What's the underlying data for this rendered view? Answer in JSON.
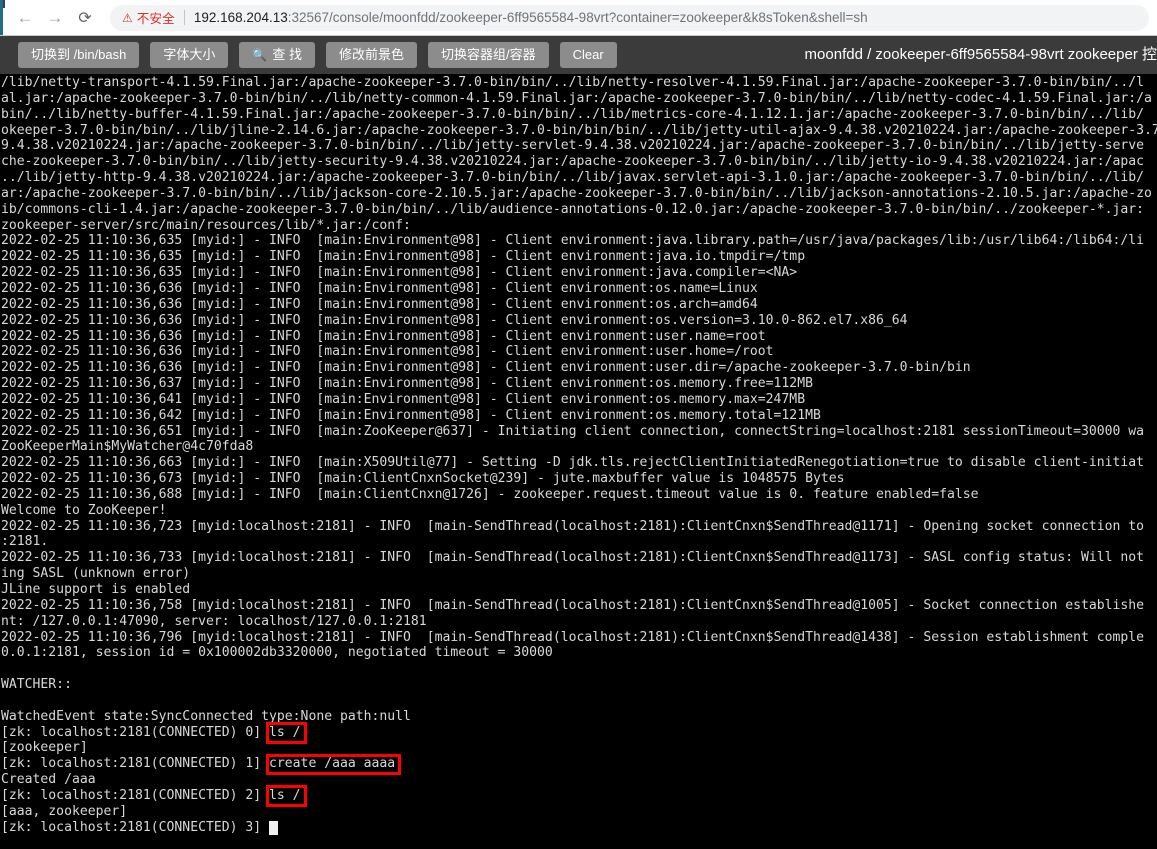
{
  "browser": {
    "back_icon": "back-arrow-icon",
    "forward_icon": "forward-arrow-icon",
    "reload_icon": "reload-icon",
    "security_warning_icon": "warning-triangle-icon",
    "security_warning_text": "不安全",
    "url_host": "192.168.204.13",
    "url_rest": ":32567/console/moonfdd/zookeeper-6ff9565584-98vrt?container=zookeeper&k8sToken&shell=sh",
    "url_full": "192.168.204.13:32567/console/moonfdd/zookeeper-6ff9565584-98vrt?container=zookeeper&k8sToken&shell=sh"
  },
  "toolbar": {
    "buttons": [
      {
        "label": "切换到 /bin/bash",
        "name": "switch-to-bin-bash-button",
        "icon": ""
      },
      {
        "label": "字体大小",
        "name": "font-size-button",
        "icon": ""
      },
      {
        "label": "查 找",
        "name": "find-button",
        "icon": "search-icon"
      },
      {
        "label": "修改前景色",
        "name": "change-foreground-color-button",
        "icon": ""
      },
      {
        "label": "切换容器组/容器",
        "name": "switch-pod-container-button",
        "icon": ""
      },
      {
        "label": "Clear",
        "name": "clear-button",
        "icon": ""
      }
    ],
    "heading": "moonfdd / zookeeper-6ff9565584-98vrt zookeeper 控"
  },
  "terminal": {
    "accent_highlight_color": "#ff0000",
    "foreground_color": "#d8d8d8",
    "background_color": "#000000",
    "lines": [
      "/lib/netty-transport-4.1.59.Final.jar:/apache-zookeeper-3.7.0-bin/bin/../lib/netty-resolver-4.1.59.Final.jar:/apache-zookeeper-3.7.0-bin/bin/../l",
      "al.jar:/apache-zookeeper-3.7.0-bin/bin/../lib/netty-common-4.1.59.Final.jar:/apache-zookeeper-3.7.0-bin/bin/../lib/netty-codec-4.1.59.Final.jar:/a",
      "bin/../lib/netty-buffer-4.1.59.Final.jar:/apache-zookeeper-3.7.0-bin/bin/../lib/metrics-core-4.1.12.1.jar:/apache-zookeeper-3.7.0-bin/bin/../lib/",
      "okeeper-3.7.0-bin/bin/../lib/jline-2.14.6.jar:/apache-zookeeper-3.7.0-bin/bin/bin/../lib/jetty-util-ajax-9.4.38.v20210224.jar:/apache-zookeeper-3.7.0",
      "9.4.38.v20210224.jar:/apache-zookeeper-3.7.0-bin/bin/../lib/jetty-servlet-9.4.38.v20210224.jar:/apache-zookeeper-3.7.0-bin/bin/../lib/jetty-serve",
      "che-zookeeper-3.7.0-bin/bin/../lib/jetty-security-9.4.38.v20210224.jar:/apache-zookeeper-3.7.0-bin/bin/../lib/jetty-io-9.4.38.v20210224.jar:/apac",
      "../lib/jetty-http-9.4.38.v20210224.jar:/apache-zookeeper-3.7.0-bin/bin/../lib/javax.servlet-api-3.1.0.jar:/apache-zookeeper-3.7.0-bin/bin/../lib/",
      "ar:/apache-zookeeper-3.7.0-bin/bin/../lib/jackson-core-2.10.5.jar:/apache-zookeeper-3.7.0-bin/bin/../lib/jackson-annotations-2.10.5.jar:/apache-zo",
      "ib/commons-cli-1.4.jar:/apache-zookeeper-3.7.0-bin/bin/../lib/audience-annotations-0.12.0.jar:/apache-zookeeper-3.7.0-bin/bin/../zookeeper-*.jar:",
      "zookeeper-server/src/main/resources/lib/*.jar:/conf:",
      "2022-02-25 11:10:36,635 [myid:] - INFO  [main:Environment@98] - Client environment:java.library.path=/usr/java/packages/lib:/usr/lib64:/lib64:/li",
      "2022-02-25 11:10:36,635 [myid:] - INFO  [main:Environment@98] - Client environment:java.io.tmpdir=/tmp",
      "2022-02-25 11:10:36,635 [myid:] - INFO  [main:Environment@98] - Client environment:java.compiler=<NA>",
      "2022-02-25 11:10:36,636 [myid:] - INFO  [main:Environment@98] - Client environment:os.name=Linux",
      "2022-02-25 11:10:36,636 [myid:] - INFO  [main:Environment@98] - Client environment:os.arch=amd64",
      "2022-02-25 11:10:36,636 [myid:] - INFO  [main:Environment@98] - Client environment:os.version=3.10.0-862.el7.x86_64",
      "2022-02-25 11:10:36,636 [myid:] - INFO  [main:Environment@98] - Client environment:user.name=root",
      "2022-02-25 11:10:36,636 [myid:] - INFO  [main:Environment@98] - Client environment:user.home=/root",
      "2022-02-25 11:10:36,636 [myid:] - INFO  [main:Environment@98] - Client environment:user.dir=/apache-zookeeper-3.7.0-bin/bin",
      "2022-02-25 11:10:36,637 [myid:] - INFO  [main:Environment@98] - Client environment:os.memory.free=112MB",
      "2022-02-25 11:10:36,641 [myid:] - INFO  [main:Environment@98] - Client environment:os.memory.max=247MB",
      "2022-02-25 11:10:36,642 [myid:] - INFO  [main:Environment@98] - Client environment:os.memory.total=121MB",
      "2022-02-25 11:10:36,651 [myid:] - INFO  [main:ZooKeeper@637] - Initiating client connection, connectString=localhost:2181 sessionTimeout=30000 wa",
      "ZooKeeperMain$MyWatcher@4c70fda8",
      "2022-02-25 11:10:36,663 [myid:] - INFO  [main:X509Util@77] - Setting -D jdk.tls.rejectClientInitiatedRenegotiation=true to disable client-initiat",
      "2022-02-25 11:10:36,673 [myid:] - INFO  [main:ClientCnxnSocket@239] - jute.maxbuffer value is 1048575 Bytes",
      "2022-02-25 11:10:36,688 [myid:] - INFO  [main:ClientCnxn@1726] - zookeeper.request.timeout value is 0. feature enabled=false",
      "Welcome to ZooKeeper!",
      "2022-02-25 11:10:36,723 [myid:localhost:2181] - INFO  [main-SendThread(localhost:2181):ClientCnxn$SendThread@1171] - Opening socket connection to",
      ":2181.",
      "2022-02-25 11:10:36,733 [myid:localhost:2181] - INFO  [main-SendThread(localhost:2181):ClientCnxn$SendThread@1173] - SASL config status: Will not",
      "ing SASL (unknown error)",
      "JLine support is enabled",
      "2022-02-25 11:10:36,758 [myid:localhost:2181] - INFO  [main-SendThread(localhost:2181):ClientCnxn$SendThread@1005] - Socket connection establishe",
      "nt: /127.0.0.1:47090, server: localhost/127.0.0.1:2181",
      "2022-02-25 11:10:36,796 [myid:localhost:2181] - INFO  [main-SendThread(localhost:2181):ClientCnxn$SendThread@1438] - Session establishment comple",
      "0.0.1:2181, session id = 0x100002db3320000, negotiated timeout = 30000",
      "",
      "WATCHER::",
      "",
      "WatchedEvent state:SyncConnected type:None path:null",
      "[zk: localhost:2181(CONNECTED) 0] ls /",
      "[zookeeper]",
      "[zk: localhost:2181(CONNECTED) 1] create /aaa aaaa",
      "Created /aaa",
      "[zk: localhost:2181(CONNECTED) 2] ls /",
      "[aaa, zookeeper]",
      "[zk: localhost:2181(CONNECTED) 3] "
    ],
    "highlighted_commands": [
      {
        "command": "ls /",
        "prompt_index": "0",
        "name": "highlight-ls-root-first"
      },
      {
        "command": "create /aaa aaaa",
        "prompt_index": "1",
        "name": "highlight-create-aaa"
      },
      {
        "command": "ls /",
        "prompt_index": "2",
        "name": "highlight-ls-root-second"
      }
    ],
    "cursor": {
      "prompt_index": "3",
      "name": "terminal-cursor"
    }
  }
}
